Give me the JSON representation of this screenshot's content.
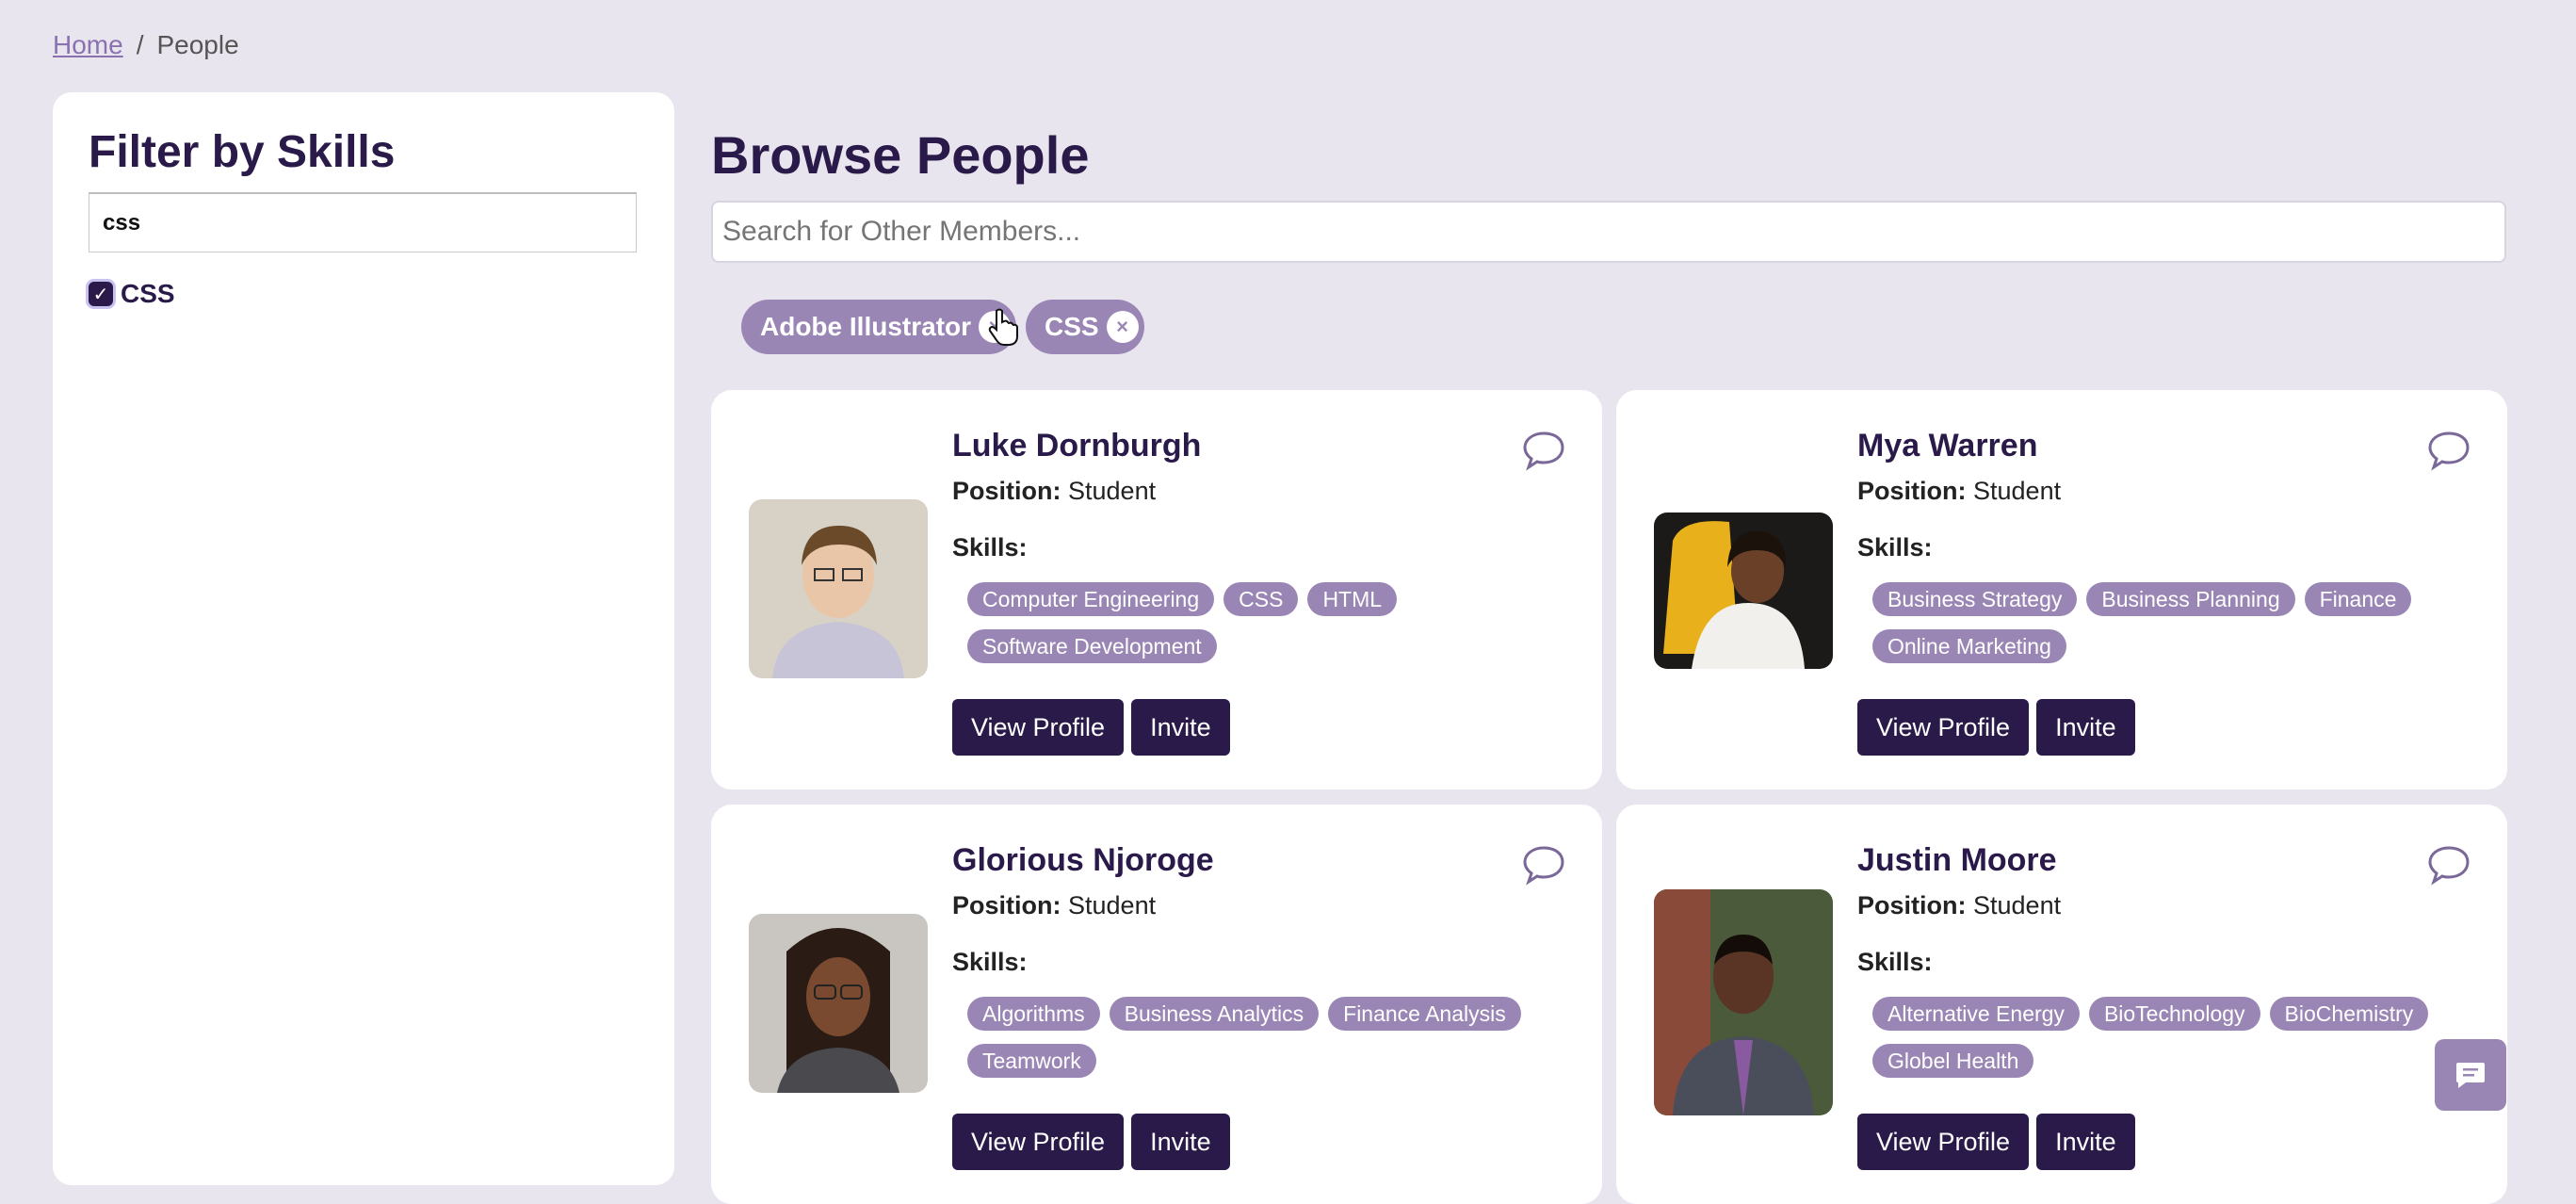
{
  "breadcrumb": {
    "home": "Home",
    "separator": "/",
    "current": "People"
  },
  "sidebar": {
    "title": "Filter by Skills",
    "filter_value": "css",
    "checked_skill": "CSS"
  },
  "main": {
    "title": "Browse People",
    "search_placeholder": "Search for Other Members...",
    "active_filters": [
      "Adobe Illustrator",
      "CSS"
    ],
    "remove_glyph": "×"
  },
  "labels": {
    "position": "Position:",
    "skills": "Skills:",
    "view_profile": "View Profile",
    "invite": "Invite"
  },
  "people": [
    {
      "name": "Luke Dornburgh",
      "position": "Student",
      "skills": [
        "Computer Engineering",
        "CSS",
        "HTML",
        "Software Development"
      ]
    },
    {
      "name": "Mya Warren",
      "position": "Student",
      "skills": [
        "Business Strategy",
        "Business Planning",
        "Finance",
        "Online Marketing"
      ]
    },
    {
      "name": "Glorious Njoroge",
      "position": "Student",
      "skills": [
        "Algorithms",
        "Business Analytics",
        "Finance Analysis",
        "Teamwork"
      ]
    },
    {
      "name": "Justin Moore",
      "position": "Student",
      "skills": [
        "Alternative Energy",
        "BioTechnology",
        "BioChemistry",
        "Globel Health"
      ]
    }
  ],
  "icons": {
    "chat": "chat-bubble-icon",
    "fab": "message-icon",
    "cursor": "hand-pointer-icon"
  },
  "colors": {
    "accent": "#2a1a4a",
    "tag": "#9a86b4",
    "background": "#e8e5ee"
  }
}
